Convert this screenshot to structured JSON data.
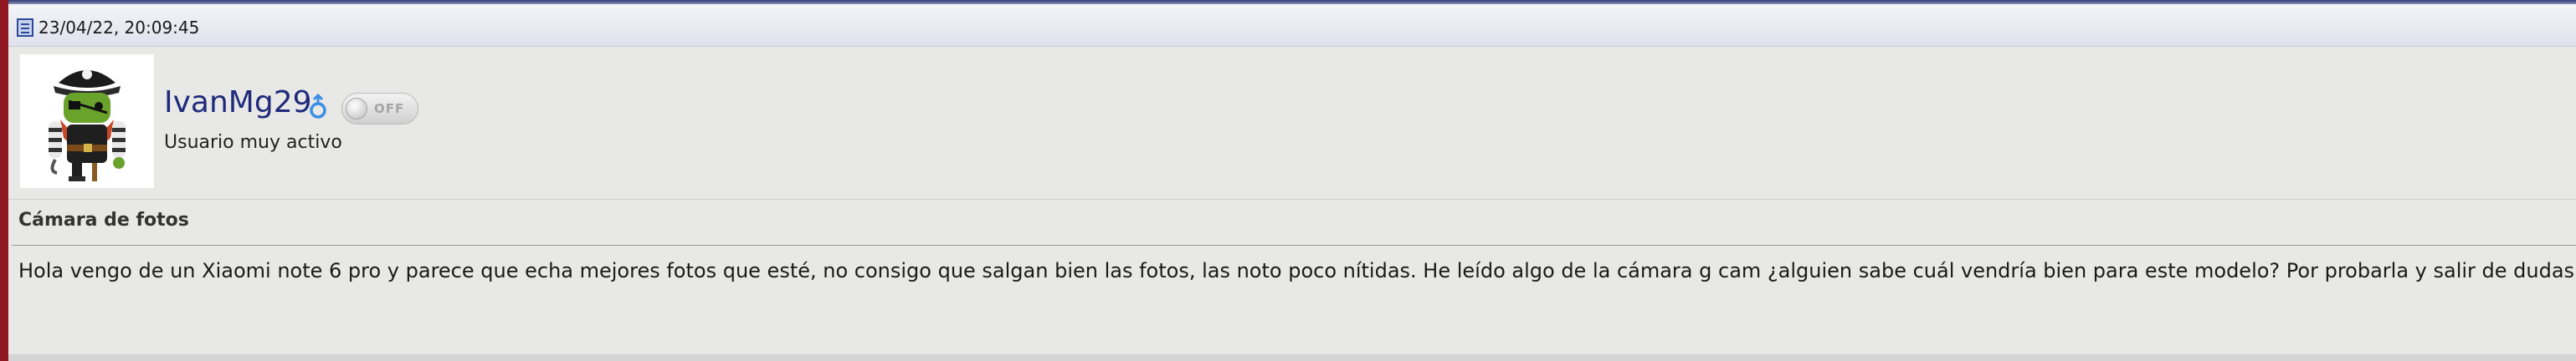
{
  "post": {
    "date": "23/04/22, 20:09:45",
    "icons": {
      "post": "post-document-icon",
      "gender": "male-gender-icon",
      "status": "offline-toggle-icon"
    },
    "user": {
      "username": "IvanMg29",
      "title": "Usuario muy activo",
      "status": "OFF",
      "avatar": "pirate-android-avatar"
    },
    "title": "Cámara de fotos",
    "body": "Hola vengo de un Xiaomi note 6 pro y parece que echa mejores fotos que esté, no consigo que salgan bien las fotos, las noto poco nítidas. He leído algo de la cámara g cam ¿alguien sabe cuál vendría bien para este modelo? Por probarla y salir de dudas."
  },
  "colors": {
    "accent": "#8f1820",
    "username": "#1f2a7a",
    "header": "#2f3a73"
  }
}
